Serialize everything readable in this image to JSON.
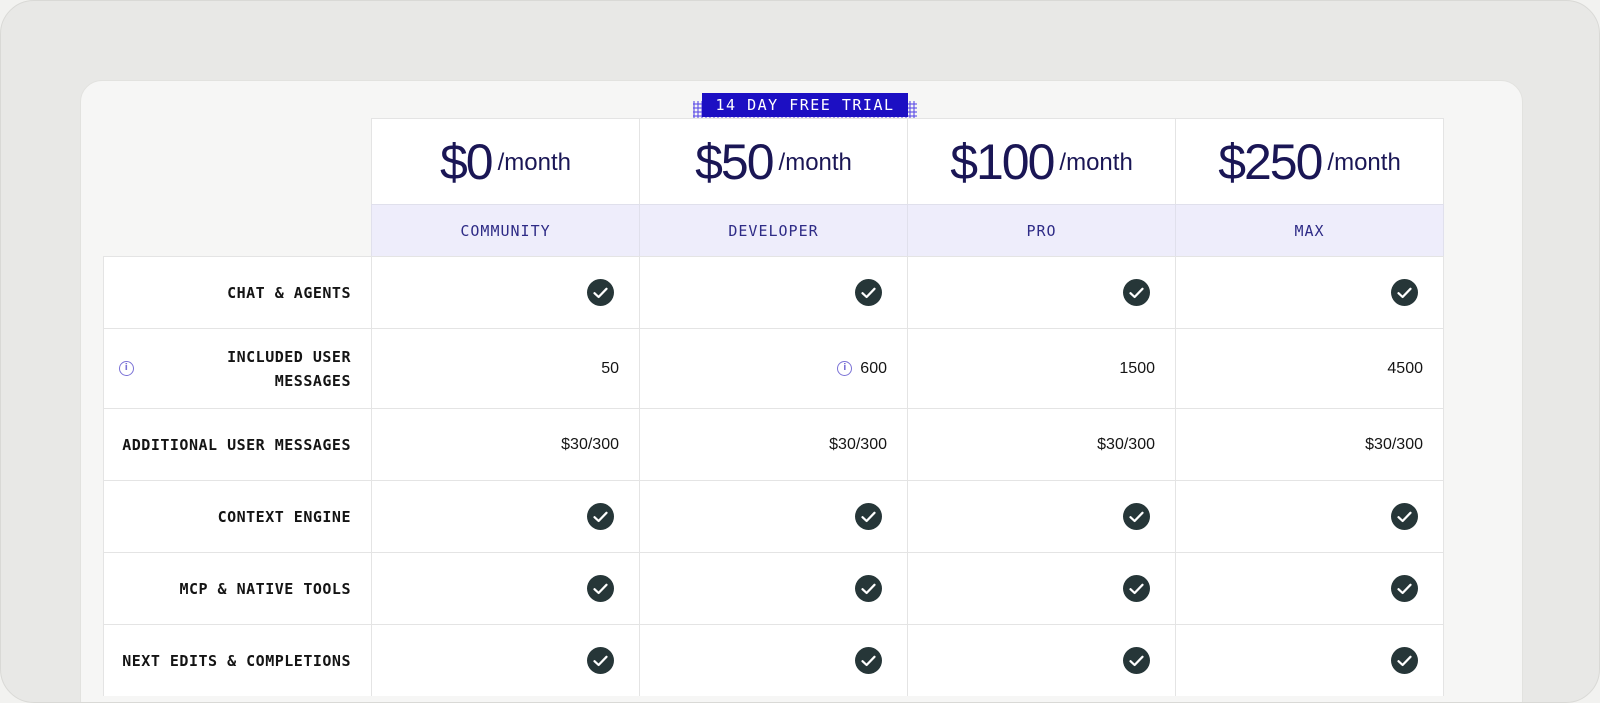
{
  "badge": "14 DAY FREE TRIAL",
  "plans": [
    {
      "price": "$0",
      "period": "/month",
      "name": "COMMUNITY"
    },
    {
      "price": "$50",
      "period": "/month",
      "name": "DEVELOPER"
    },
    {
      "price": "$100",
      "period": "/month",
      "name": "PRO"
    },
    {
      "price": "$250",
      "period": "/month",
      "name": "MAX"
    }
  ],
  "rows": [
    {
      "label": "CHAT & AGENTS",
      "values": [
        "check",
        "check",
        "check",
        "check"
      ]
    },
    {
      "label": "INCLUDED USER MESSAGES",
      "label_lines": [
        "INCLUDED USER",
        "MESSAGES"
      ],
      "values": [
        "50",
        "600",
        "1500",
        "4500"
      ]
    },
    {
      "label": "ADDITIONAL USER MESSAGES",
      "values": [
        "$30/300",
        "$30/300",
        "$30/300",
        "$30/300"
      ]
    },
    {
      "label": "CONTEXT ENGINE",
      "values": [
        "check",
        "check",
        "check",
        "check"
      ]
    },
    {
      "label": "MCP & NATIVE TOOLS",
      "values": [
        "check",
        "check",
        "check",
        "check"
      ]
    },
    {
      "label": "NEXT EDITS & COMPLETIONS",
      "values": [
        "check",
        "check",
        "check",
        "check"
      ]
    }
  ],
  "colors": {
    "accent": "#1c0fc3",
    "price_text": "#1a1655",
    "tier_bg": "#eeedfb",
    "check_bg": "#263638"
  },
  "icons": {
    "check": "check-circle-icon",
    "info": "info-icon"
  }
}
